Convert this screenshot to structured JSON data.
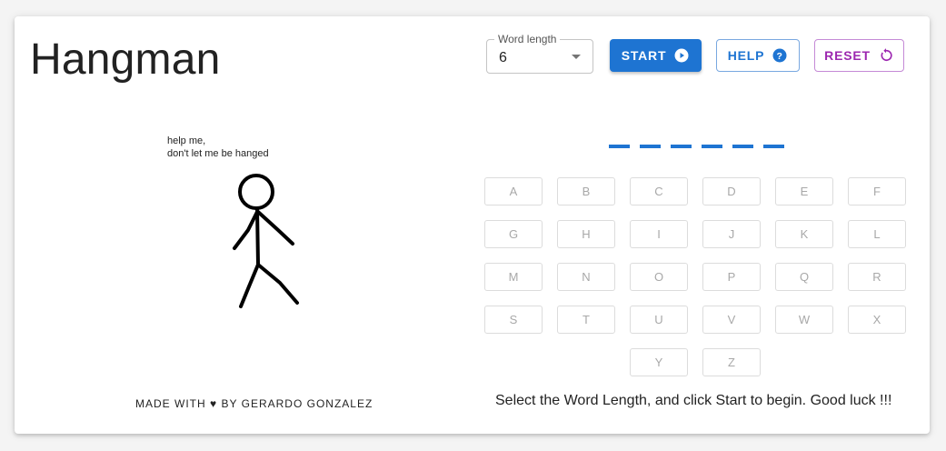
{
  "header": {
    "title": "Hangman",
    "word_length": {
      "label": "Word length",
      "value": "6"
    },
    "start_label": "START",
    "help_label": "HELP",
    "reset_label": "RESET"
  },
  "colors": {
    "primary": "#1e74d2",
    "secondary": "#9c27b0",
    "disabled_text": "#a8a8a8"
  },
  "gallows": {
    "speech_line1": "help me,",
    "speech_line2": "don't let me be hanged"
  },
  "footer": {
    "credits_before": "MADE WITH",
    "credits_after": "BY GERARDO GONZALEZ",
    "heart_icon": "heart-icon"
  },
  "word": {
    "blank_count": 6
  },
  "letters": [
    "A",
    "B",
    "C",
    "D",
    "E",
    "F",
    "G",
    "H",
    "I",
    "J",
    "K",
    "L",
    "M",
    "N",
    "O",
    "P",
    "Q",
    "R",
    "S",
    "T",
    "U",
    "V",
    "W",
    "X",
    "Y",
    "Z"
  ],
  "message": "Select the Word Length, and click Start to begin. Good luck !!!"
}
